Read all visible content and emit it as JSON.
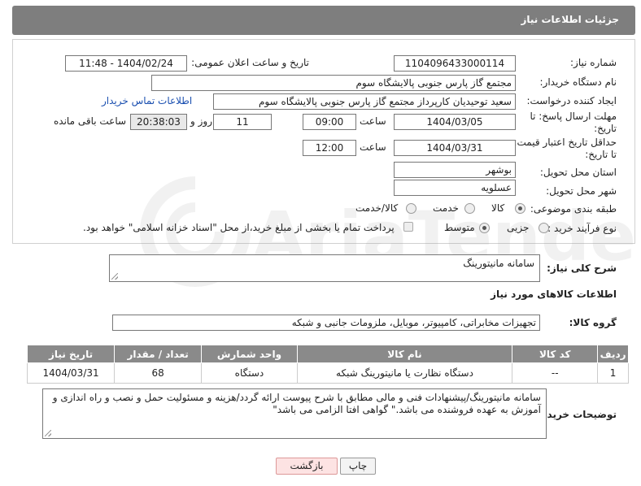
{
  "header": {
    "title": "جزئیات اطلاعات نیاز"
  },
  "form": {
    "need_number": {
      "label": "شماره نیاز:",
      "value": "1104096433000114"
    },
    "announce_datetime": {
      "label": "تاریخ و ساعت اعلان عمومی:",
      "value": "1404/02/24 - 11:48"
    },
    "buyer_org": {
      "label": "نام دستگاه خریدار:",
      "value": "مجتمع گاز پارس جنوبی  پالایشگاه سوم"
    },
    "requester": {
      "label": "ایجاد کننده درخواست:",
      "value": "سعید توحیدیان کارپرداز مجتمع گاز پارس جنوبی  پالایشگاه سوم",
      "contact_link": "اطلاعات تماس خریدار"
    },
    "response_deadline": {
      "label_line1": "مهلت ارسال پاسخ: تا",
      "label_line2": "تاریخ:",
      "date": "1404/03/05",
      "time_label": "ساعت",
      "time": "09:00",
      "days": "11",
      "days_label": "روز و",
      "remaining": "20:38:03",
      "remaining_label": "ساعت باقی مانده"
    },
    "price_validity": {
      "label_line1": "حداقل تاریخ اعتبار قیمت:",
      "label_line2": "تا تاریخ:",
      "date": "1404/03/31",
      "time_label": "ساعت",
      "time": "12:00"
    },
    "delivery_province": {
      "label": "استان محل تحویل:",
      "value": "بوشهر"
    },
    "delivery_city": {
      "label": "شهر محل تحویل:",
      "value": "عسلویه"
    },
    "category": {
      "label": "طبقه بندی موضوعی:",
      "options": [
        "کالا",
        "خدمت",
        "کالا/خدمت"
      ],
      "selected": "کالا"
    },
    "process_type": {
      "label": "نوع فرآیند خرید :",
      "options": [
        "جزیی",
        "متوسط"
      ],
      "selected": "متوسط",
      "payment_note": "پرداخت تمام یا بخشی از مبلغ خرید،از محل \"اسناد خزانه اسلامی\" خواهد بود."
    }
  },
  "summary": {
    "label": "شرح کلی نیاز:",
    "value": "سامانه مانیتورینگ"
  },
  "goods_section": {
    "title": "اطلاعات کالاهای مورد نیاز"
  },
  "goods_group": {
    "label": "گروه کالا:",
    "value": "تجهیزات مخابراتی، کامپیوتر، موبایل، ملزومات جانبی و شبکه"
  },
  "table": {
    "headers": [
      "ردیف",
      "کد کالا",
      "نام کالا",
      "واحد شمارش",
      "تعداد / مقدار",
      "تاریخ نیاز"
    ],
    "rows": [
      [
        "1",
        "--",
        "دستگاه نظارت یا مانیتورینگ شبکه",
        "دستگاه",
        "68",
        "1404/03/31"
      ]
    ]
  },
  "buyer_notes": {
    "label": "توضیحات خریدار:",
    "value": "سامانه مانیتورینگ/پیشنهادات فنی و مالی مطابق با شرح پیوست ارائه گردد/هزینه و مسئولیت حمل و نصب و راه اندازی و آموزش به عهده فروشنده می باشد.\" گواهی افتا الزامی می باشد\""
  },
  "buttons": {
    "print": "چاپ",
    "back": "بازگشت"
  },
  "watermark": {
    "text": "AriaTender.net"
  }
}
